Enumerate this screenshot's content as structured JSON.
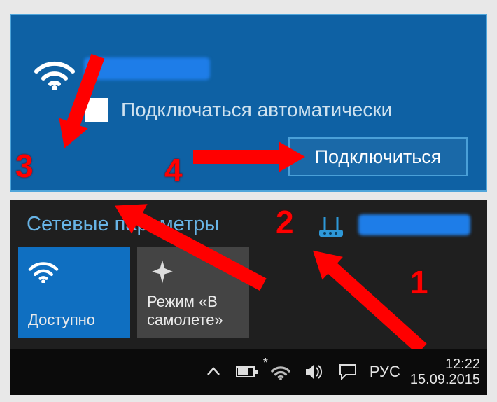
{
  "network_item": {
    "auto_connect_label": "Подключаться автоматически",
    "connect_button": "Подключиться"
  },
  "network_settings": {
    "title": "Сетевые параметры",
    "tiles": {
      "wifi": {
        "label": "Доступно"
      },
      "airplane": {
        "label": "Режим «В\nсамолете»"
      }
    }
  },
  "taskbar": {
    "language": "РУС",
    "time": "12:22",
    "date": "15.09.2015"
  },
  "annotations": {
    "n1": "1",
    "n2": "2",
    "n3": "3",
    "n4": "4"
  }
}
